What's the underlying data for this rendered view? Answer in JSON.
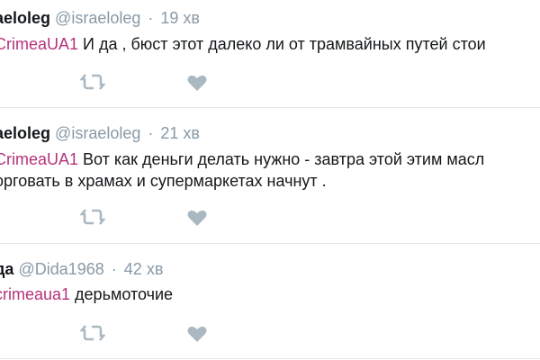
{
  "tweets": [
    {
      "author": "aeloleg",
      "handle": "@israeloleg",
      "separator": "·",
      "time": "19 хв",
      "mention": "CrimeaUA1",
      "text": " И да , бюст этот далеко ли от трамвайных путей стои",
      "continuation": ""
    },
    {
      "author": "aeloleg",
      "handle": "@israeloleg",
      "separator": "·",
      "time": "21 хв",
      "mention": "CrimeaUA1",
      "text": " Вот как деньги делать нужно - завтра этой этим масл",
      "continuation": "орговать в храмах и супермаркетах начнут ."
    },
    {
      "author": "да",
      "handle": "@Dida1968",
      "separator": "·",
      "time": "42 хв",
      "mention": "crimeaua1",
      "text": " дерьмоточие",
      "continuation": ""
    }
  ],
  "icons": {
    "retweet": "retweet-icon",
    "like": "heart-icon"
  },
  "colors": {
    "mention": "#b5327a",
    "muted": "#8899a6",
    "icon": "#aab8c2",
    "divider": "#e1e8ed"
  }
}
